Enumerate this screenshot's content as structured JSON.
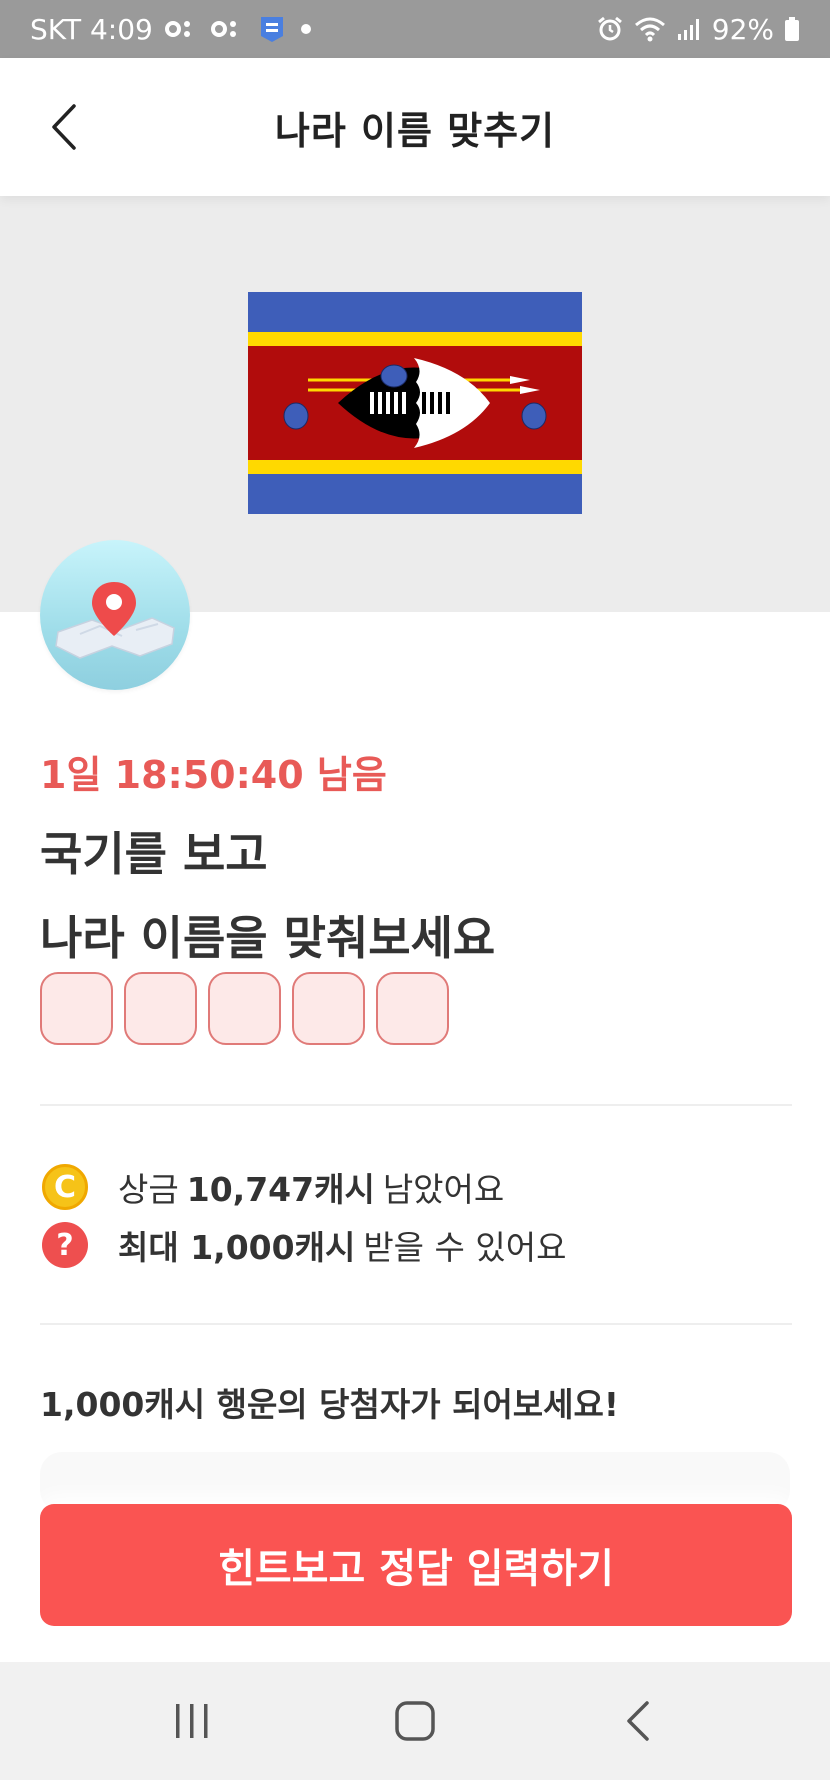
{
  "status_bar": {
    "carrier_time": "SKT 4:09",
    "battery": "92%",
    "icons": [
      "notification-icon",
      "notification-icon",
      "app-badge-icon",
      "dot-icon",
      "alarm-icon",
      "wifi-icon",
      "signal-icon",
      "battery-icon"
    ]
  },
  "header": {
    "title": "나라 이름 맞추기",
    "back_icon": "chevron-left-icon"
  },
  "quiz": {
    "flag_icon": "eswatini-flag",
    "badge_icon": "map-pin-icon",
    "countdown": "1일 18:50:40 남음",
    "question_line1": "국기를 보고",
    "question_line2": "나라 이름을 맞춰보세요",
    "answer_slots": [
      "",
      "",
      "",
      "",
      ""
    ]
  },
  "info": {
    "prize_prefix": "상금 ",
    "prize_amount": "10,747캐시",
    "prize_suffix": " 남았어요",
    "max_prefix": "최대 1,000캐시",
    "max_suffix": " 받을 수 있어요",
    "coin_icon_label": "C",
    "help_icon_label": "?"
  },
  "lucky_text": "1,000캐시 행운의 당첨자가 되어보세요!",
  "cta": {
    "label": "힌트보고 정답 입력하기"
  },
  "nav": {
    "recents_icon": "recents-icon",
    "home_icon": "home-icon",
    "back_icon": "back-icon"
  },
  "colors": {
    "accent": "#fa5452",
    "countdown": "#e85a57",
    "status_bar": "#9a9a9a",
    "flag_blue": "#3e5eb9",
    "flag_yellow": "#ffd900",
    "flag_red": "#b10c0c"
  }
}
